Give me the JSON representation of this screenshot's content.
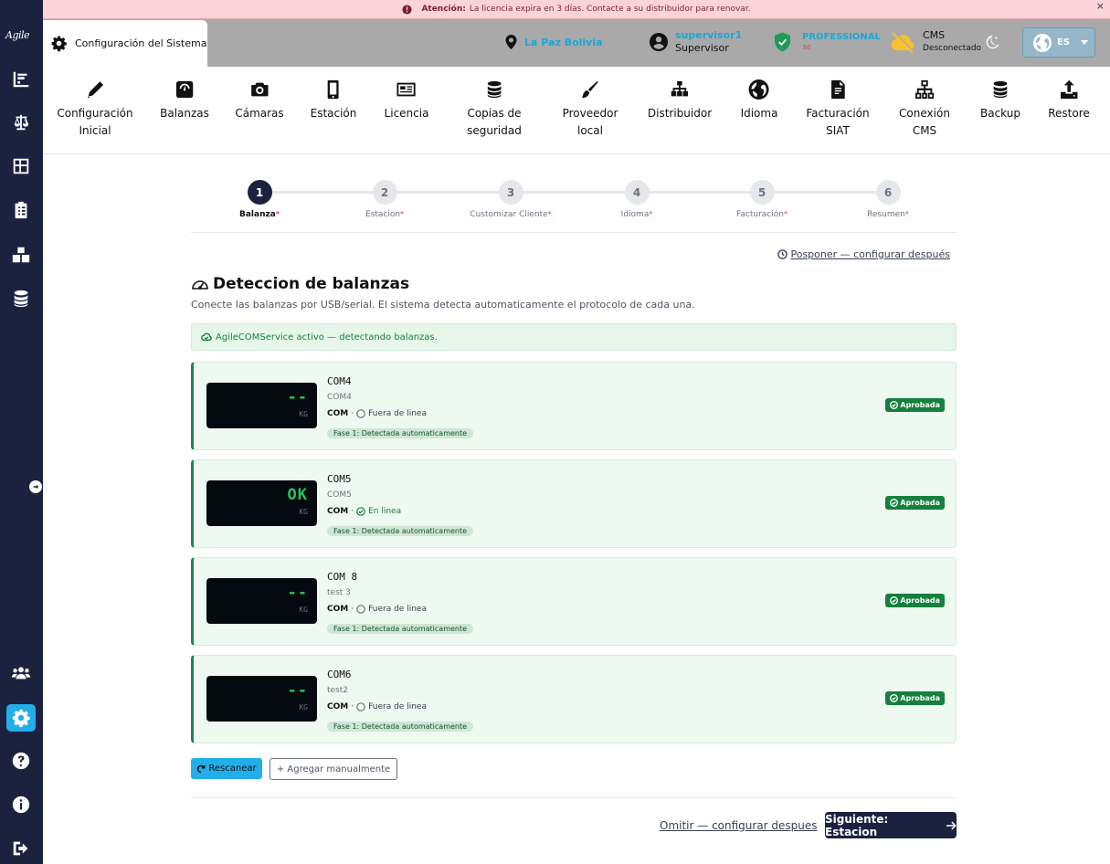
{
  "alert": {
    "bold": "Atención:",
    "text": "La licencia expira en 3 días. Contacte a su distribuidor para renovar.",
    "close": "×"
  },
  "sidebar": {
    "logo": "Agile"
  },
  "header": {
    "page_title": "Configuración del Sistema",
    "location": "La Paz Bolivia",
    "user_name": "supervisor1",
    "user_role": "Supervisor",
    "license_plan": "PROFESSIONAL",
    "license_days": "3d",
    "cms_label": "CMS",
    "cms_status": "Desconectado",
    "language": "ES"
  },
  "tools": [
    {
      "icon": "pencil-icon",
      "label": "Configuración\nInicial"
    },
    {
      "icon": "scale-icon",
      "label": "Balanzas"
    },
    {
      "icon": "camera-icon",
      "label": "Cámaras"
    },
    {
      "icon": "mobile-icon",
      "label": "Estación"
    },
    {
      "icon": "id-card-icon",
      "label": "Licencia"
    },
    {
      "icon": "database-icon",
      "label": "Copias de\nseguridad"
    },
    {
      "icon": "brush-icon",
      "label": "Proveedor\nlocal"
    },
    {
      "icon": "sitemap-icon",
      "label": "Distribuidor"
    },
    {
      "icon": "globe-icon",
      "label": "Idioma"
    },
    {
      "icon": "invoice-icon",
      "label": "Facturación\nSIAT"
    },
    {
      "icon": "network-icon",
      "label": "Conexión\nCMS"
    },
    {
      "icon": "database-icon",
      "label": "Backup"
    },
    {
      "icon": "upload-icon",
      "label": "Restore"
    }
  ],
  "steps": [
    {
      "num": "1",
      "label": "Balanza",
      "req": "*"
    },
    {
      "num": "2",
      "label": "Estacion",
      "req": "*"
    },
    {
      "num": "3",
      "label": "Customizar Cliente",
      "req": "*"
    },
    {
      "num": "4",
      "label": "Idioma",
      "req": "*"
    },
    {
      "num": "5",
      "label": "Facturación",
      "req": "*"
    },
    {
      "num": "6",
      "label": "Resumen",
      "req": "*"
    }
  ],
  "postpone": "Posponer — configurar después",
  "section": {
    "title": "Deteccion de balanzas",
    "description": "Conecte las balanzas por USB/serial. El sistema detecta automaticamente el protocolo de cada una.",
    "service_status": "AgileCOMService activo — detectando balanzas."
  },
  "scales": [
    {
      "name": "COM4",
      "sub": "COM4",
      "type": "COM",
      "status": "Fuera de linea",
      "online": false,
      "display": "--",
      "unit": "KG",
      "phase": "Fase 1: Detectada automaticamente",
      "badge": "Aprobada"
    },
    {
      "name": "COM5",
      "sub": "COM5",
      "type": "COM",
      "status": "En linea",
      "online": true,
      "display": "OK",
      "unit": "KG",
      "phase": "Fase 1: Detectada automaticamente",
      "badge": "Aprobada"
    },
    {
      "name": "COM 8",
      "sub": "test 3",
      "type": "COM",
      "status": "Fuera de linea",
      "online": false,
      "display": "--",
      "unit": "KG",
      "phase": "Fase 1: Detectada automaticamente",
      "badge": "Aprobada"
    },
    {
      "name": "COM6",
      "sub": "test2",
      "type": "COM",
      "status": "Fuera de linea",
      "online": false,
      "display": "--",
      "unit": "KG",
      "phase": "Fase 1: Detectada automaticamente",
      "badge": "Aprobada"
    }
  ],
  "actions": {
    "rescan": "Rescanear",
    "add_manual": "+ Agregar manualmente",
    "skip": "Omitir — configurar despues",
    "next": "Siguiente: Estacion"
  },
  "colors": {
    "sidebar": "#1b2240",
    "accent": "#22aee8",
    "success": "#15803d",
    "alert_bg": "#fbd4d9"
  }
}
